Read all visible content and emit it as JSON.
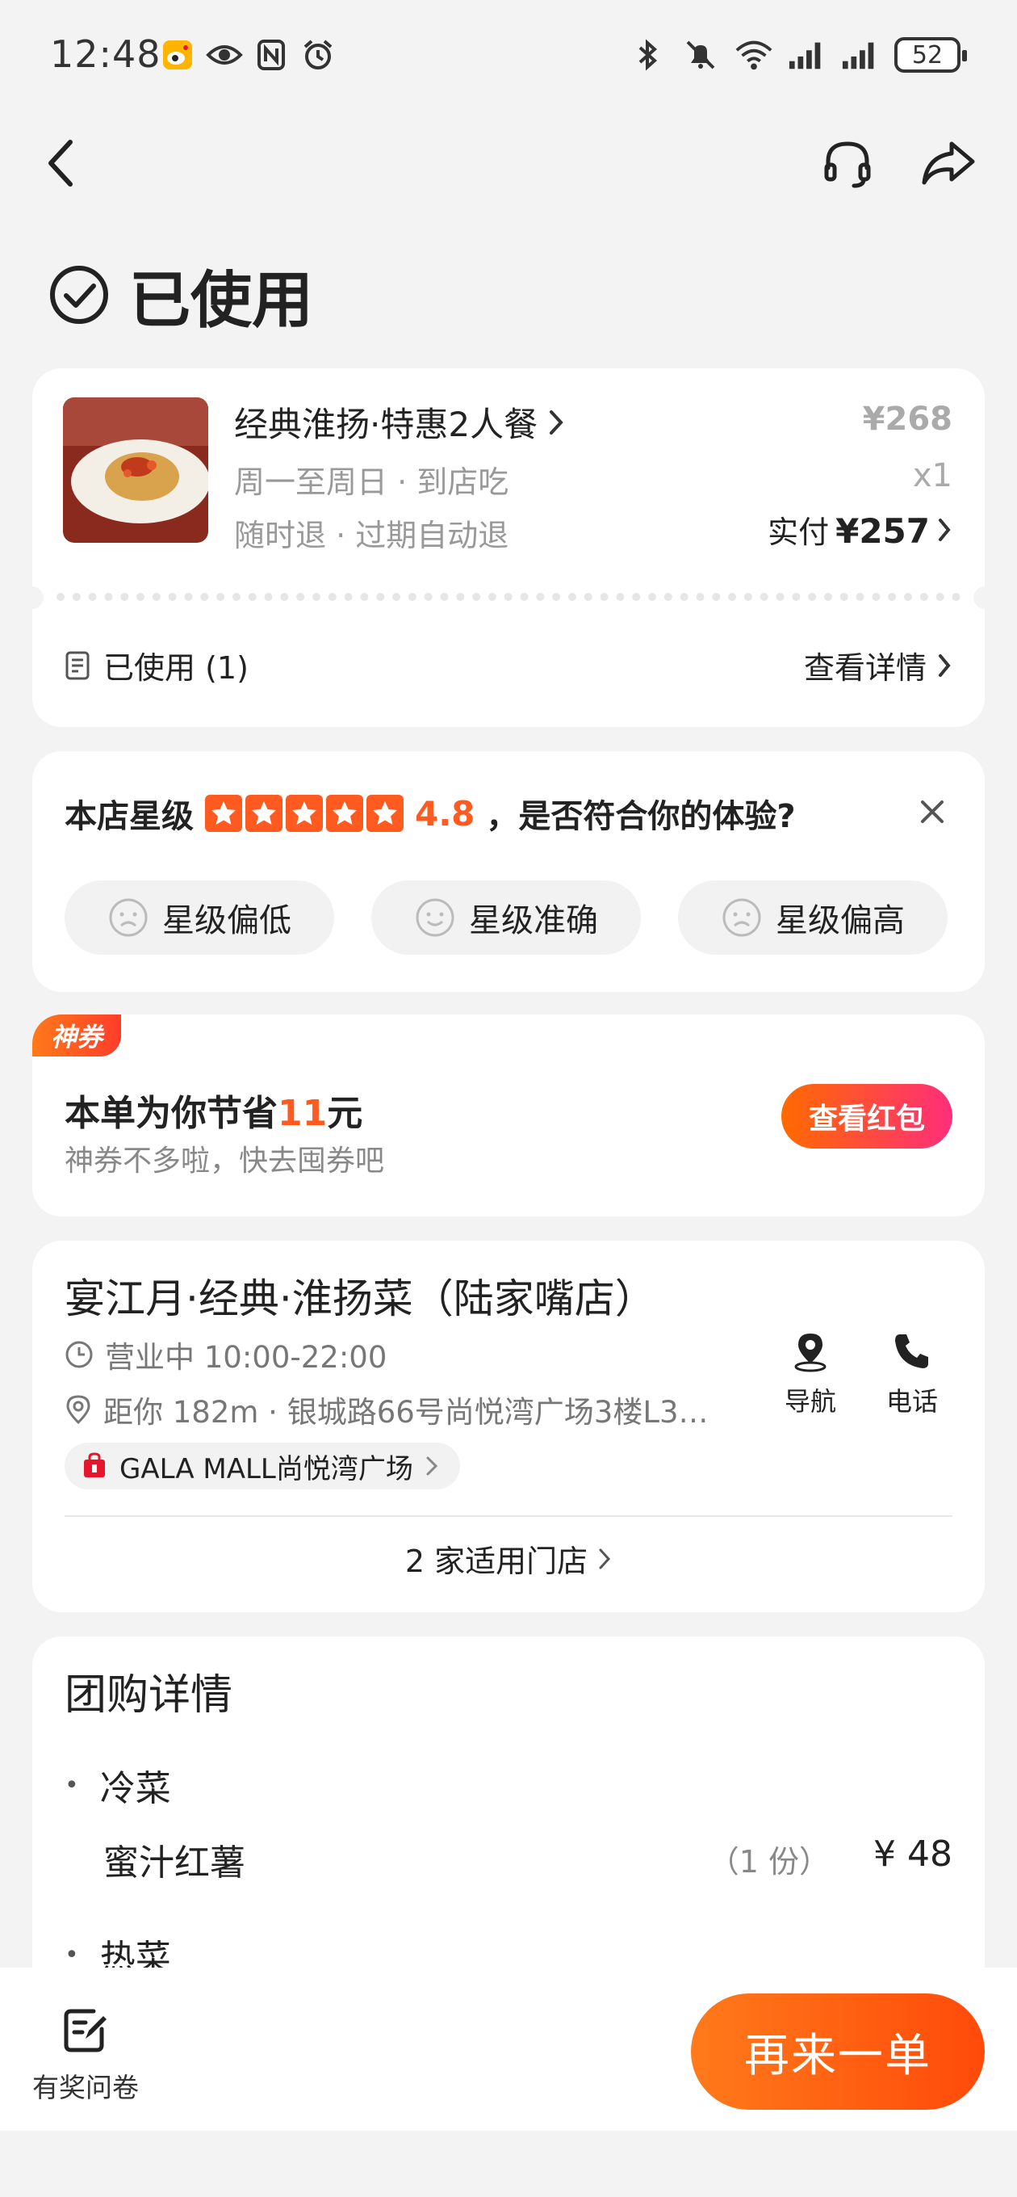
{
  "status_bar": {
    "time": "12:48",
    "left_icons": [
      "weibo-icon",
      "eye-icon",
      "nfc-icon",
      "alarm-icon"
    ],
    "right_icons": [
      "bluetooth-icon",
      "mute-icon",
      "wifi-icon",
      "signal-icon",
      "signal-icon"
    ],
    "battery": "52"
  },
  "nav": {
    "back_icon": "chevron-left-icon",
    "service_icon": "headset-icon",
    "share_icon": "share-icon"
  },
  "order_status": "已使用",
  "order": {
    "title": "经典淮扬·特惠2人餐",
    "sub1": "周一至周日 · 到店吃",
    "sub2": "随时退 · 过期自动退",
    "orig_price": "¥268",
    "qty": "x1",
    "paid_label": "实付",
    "paid_amount": "¥257",
    "used_label": "已使用 (1)",
    "detail_link": "查看详情"
  },
  "rating": {
    "label": "本店星级",
    "stars": 5,
    "score": "4.8",
    "question": "，是否符合你的体验?",
    "options": [
      "星级偏低",
      "星级准确",
      "星级偏高"
    ]
  },
  "coupon": {
    "tag": "神券",
    "title_prefix": "本单为你节省",
    "amount": "11",
    "title_suffix": "元",
    "subtitle": "神券不多啦，快去囤券吧",
    "button": "查看红包"
  },
  "store": {
    "name": "宴江月·经典·淮扬菜（陆家嘴店）",
    "hours": "营业中 10:00-22:00",
    "address": "距你 182m · 银城路66号尚悦湾广场3楼L3…",
    "mall": "GALA MALL尚悦湾广场",
    "nav_label": "导航",
    "call_label": "电话",
    "stores_link": "2 家适用门店"
  },
  "group_detail": {
    "title": "团购详情",
    "categories": [
      {
        "name": "冷菜",
        "items": [
          {
            "name": "蜜汁红薯",
            "portion": "（1 份）",
            "price": "¥ 48"
          }
        ]
      },
      {
        "name": "热菜",
        "items": []
      }
    ]
  },
  "bottom": {
    "survey_label": "有奖问卷",
    "reorder_label": "再来一单"
  },
  "colors": {
    "accent": "#ff5a1f",
    "background": "#f3f3f3"
  }
}
